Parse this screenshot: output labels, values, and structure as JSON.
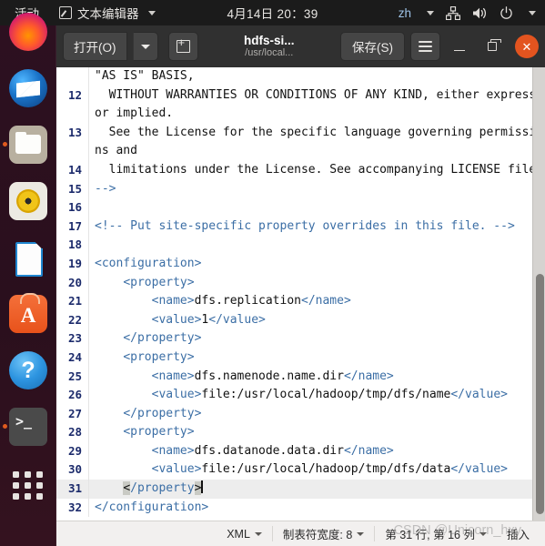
{
  "topbar": {
    "activities": "活动",
    "app_name": "文本编辑器",
    "clock": "4月14日  20：39",
    "keyboard": "zh",
    "icons": [
      "app-pencil-icon",
      "network-icon",
      "volume-icon",
      "power-icon",
      "chevron-down-icon"
    ]
  },
  "dock": {
    "items": [
      {
        "name": "firefox",
        "label": "Firefox",
        "running": false
      },
      {
        "name": "thunderbird",
        "label": "Thunderbird 邮件",
        "running": false
      },
      {
        "name": "files",
        "label": "文件",
        "running": true
      },
      {
        "name": "rhythmbox",
        "label": "Rhythmbox",
        "running": false
      },
      {
        "name": "libreoffice-impress",
        "label": "LibreOffice Impress",
        "running": false
      },
      {
        "name": "ubuntu-software",
        "label": "Ubuntu 软件",
        "running": false
      },
      {
        "name": "help",
        "label": "帮助",
        "running": false
      },
      {
        "name": "terminal",
        "label": "终端",
        "running": true
      },
      {
        "name": "show-applications",
        "label": "显示应用程序",
        "running": false
      }
    ]
  },
  "headerbar": {
    "open_label": "打开(O)",
    "new_tab_icon": "new-tab-icon",
    "title": "hdfs-si...",
    "subtitle": "/usr/local...",
    "save_label": "保存(S)",
    "menu_icon": "hamburger-menu-icon",
    "minimize_icon": "minimize-icon",
    "maximize_icon": "maximize-icon",
    "close_icon": "close-icon",
    "close_color": "#e3541f"
  },
  "editor": {
    "current_line": 31,
    "lines": [
      {
        "num": "",
        "segments": [
          {
            "t": "txt",
            "v": "\"AS IS\" BASIS,"
          }
        ]
      },
      {
        "num": "12",
        "segments": [
          {
            "t": "txt",
            "v": "  WITHOUT WARRANTIES OR CONDITIONS OF ANY KIND, either express or implied."
          }
        ]
      },
      {
        "num": "13",
        "segments": [
          {
            "t": "txt",
            "v": "  See the License for the specific language governing permissions and"
          }
        ]
      },
      {
        "num": "14",
        "segments": [
          {
            "t": "txt",
            "v": "  limitations under the License. See accompanying LICENSE file."
          }
        ]
      },
      {
        "num": "15",
        "segments": [
          {
            "t": "cmt",
            "v": "-->"
          }
        ]
      },
      {
        "num": "16",
        "segments": [
          {
            "t": "txt",
            "v": ""
          }
        ]
      },
      {
        "num": "17",
        "segments": [
          {
            "t": "cmt",
            "v": "<!-- Put site-specific property overrides in this file. -->"
          }
        ]
      },
      {
        "num": "18",
        "segments": [
          {
            "t": "txt",
            "v": ""
          }
        ]
      },
      {
        "num": "19",
        "segments": [
          {
            "t": "tag",
            "v": "<configuration>"
          }
        ]
      },
      {
        "num": "20",
        "segments": [
          {
            "t": "tag",
            "v": "    <property>"
          }
        ]
      },
      {
        "num": "21",
        "segments": [
          {
            "t": "tag",
            "v": "        <name>"
          },
          {
            "t": "txt",
            "v": "dfs.replication"
          },
          {
            "t": "tag",
            "v": "</name>"
          }
        ]
      },
      {
        "num": "22",
        "segments": [
          {
            "t": "tag",
            "v": "        <value>"
          },
          {
            "t": "txt",
            "v": "1"
          },
          {
            "t": "tag",
            "v": "</value>"
          }
        ]
      },
      {
        "num": "23",
        "segments": [
          {
            "t": "tag",
            "v": "    </property>"
          }
        ]
      },
      {
        "num": "24",
        "segments": [
          {
            "t": "tag",
            "v": "    <property>"
          }
        ]
      },
      {
        "num": "25",
        "segments": [
          {
            "t": "tag",
            "v": "        <name>"
          },
          {
            "t": "txt",
            "v": "dfs.namenode.name.dir"
          },
          {
            "t": "tag",
            "v": "</name>"
          }
        ]
      },
      {
        "num": "26",
        "segments": [
          {
            "t": "tag",
            "v": "        <value>"
          },
          {
            "t": "txt",
            "v": "file:/usr/local/hadoop/tmp/dfs/name"
          },
          {
            "t": "tag",
            "v": "</value>"
          }
        ]
      },
      {
        "num": "27",
        "segments": [
          {
            "t": "tag",
            "v": "    </property>"
          }
        ]
      },
      {
        "num": "28",
        "segments": [
          {
            "t": "tag",
            "v": "    <property>"
          }
        ]
      },
      {
        "num": "29",
        "segments": [
          {
            "t": "tag",
            "v": "        <name>"
          },
          {
            "t": "txt",
            "v": "dfs.datanode.data.dir"
          },
          {
            "t": "tag",
            "v": "</name>"
          }
        ]
      },
      {
        "num": "30",
        "segments": [
          {
            "t": "tag",
            "v": "        <value>"
          },
          {
            "t": "txt",
            "v": "file:/usr/local/hadoop/tmp/dfs/data"
          },
          {
            "t": "tag",
            "v": "</value>"
          }
        ]
      },
      {
        "num": "31",
        "current": true,
        "segments": [
          {
            "t": "brk",
            "v": "<"
          },
          {
            "t": "tag",
            "v": "/property"
          },
          {
            "t": "brk",
            "v": ">"
          }
        ],
        "indent": "    ",
        "caret": true
      },
      {
        "num": "32",
        "segments": [
          {
            "t": "tag",
            "v": "</configuration>"
          }
        ]
      }
    ]
  },
  "statusbar": {
    "language": "XML",
    "tab_width": "制表符宽度: 8",
    "position": "第 31 行, 第 16 列",
    "mode": "插入"
  },
  "watermark": "CSDN @Unicorn_hxy"
}
